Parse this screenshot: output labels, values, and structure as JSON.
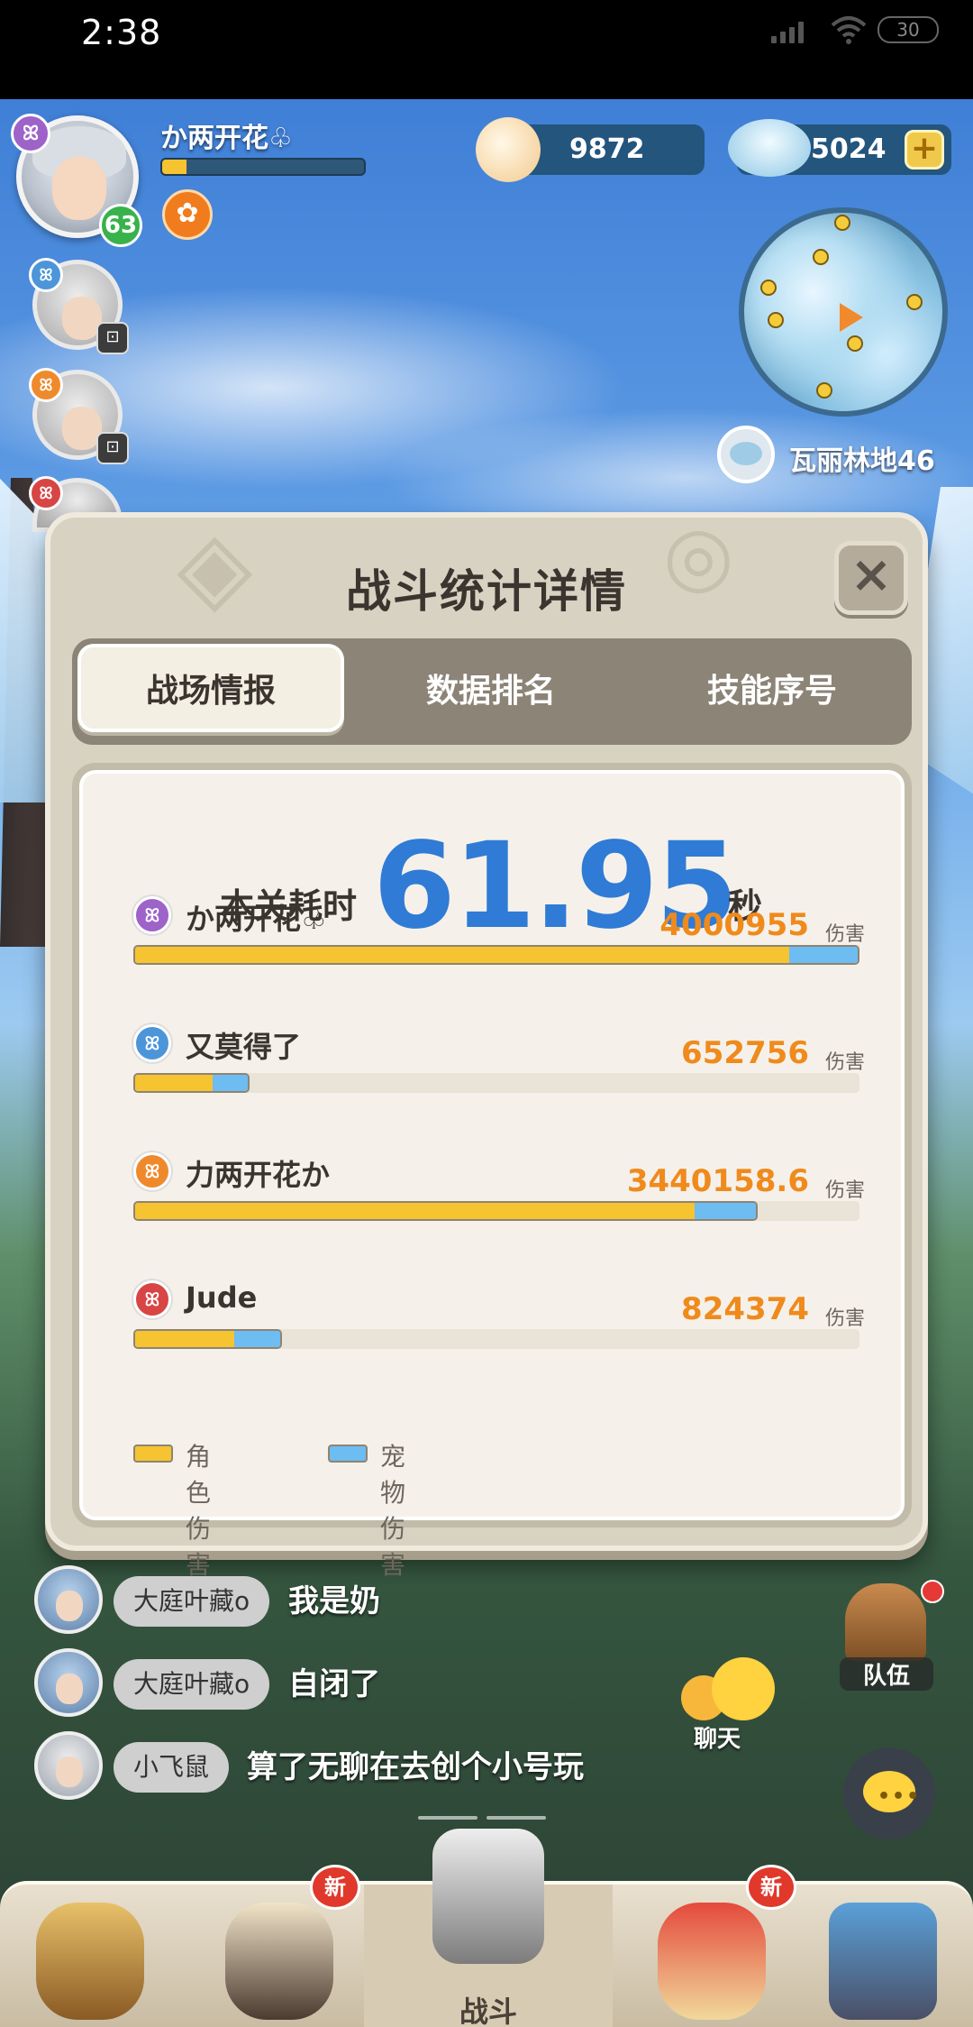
{
  "status_bar": {
    "time": "2:38",
    "battery": "30"
  },
  "player": {
    "name": "か两开花♧",
    "level": "63",
    "exp_fraction": 0.12
  },
  "currency": {
    "pearl": "9872",
    "crystal": "5024",
    "add_label": "+"
  },
  "map": {
    "location": "瓦丽林地46"
  },
  "modal": {
    "title": "战斗统计详情",
    "close_label": "×",
    "tabs": [
      {
        "label": "战场情报",
        "active": true
      },
      {
        "label": "数据排名",
        "active": false
      },
      {
        "label": "技能序号",
        "active": false
      }
    ],
    "time_label": "本关耗时",
    "time_value": "61.95",
    "time_unit": "秒",
    "damage_unit": "伤害",
    "max_damage": 4000955,
    "players": [
      {
        "name": "か两开花♧",
        "element": "purple",
        "damage": "4000955",
        "role_fraction": 0.905,
        "pet_fraction": 0.095
      },
      {
        "name": "又莫得了",
        "element": "blue",
        "damage": "652756",
        "role_fraction": 0.11,
        "pet_fraction": 0.05
      },
      {
        "name": "力两开花か",
        "element": "orange",
        "damage": "3440158.6",
        "role_fraction": 0.775,
        "pet_fraction": 0.085
      },
      {
        "name": "Jude",
        "element": "red",
        "damage": "824374",
        "role_fraction": 0.14,
        "pet_fraction": 0.065
      }
    ],
    "legend": {
      "role": "角色伤害",
      "pet": "宠物伤害"
    }
  },
  "chat": [
    {
      "name": "大庭叶藏o",
      "message": "我是奶"
    },
    {
      "name": "大庭叶藏o",
      "message": "自闭了"
    },
    {
      "name": "小飞鼠",
      "message": "算了无聊在去创个小号玩"
    }
  ],
  "side_buttons": {
    "chat_label": "聊天",
    "team_label": "队伍"
  },
  "bottom_nav": {
    "new_badge": "新",
    "battle_label": "战斗"
  },
  "colors": {
    "role_bar": "#f6c331",
    "pet_bar": "#6dbcf2",
    "time_value": "#2f7bd6",
    "damage_text": "#ef8a1c"
  }
}
